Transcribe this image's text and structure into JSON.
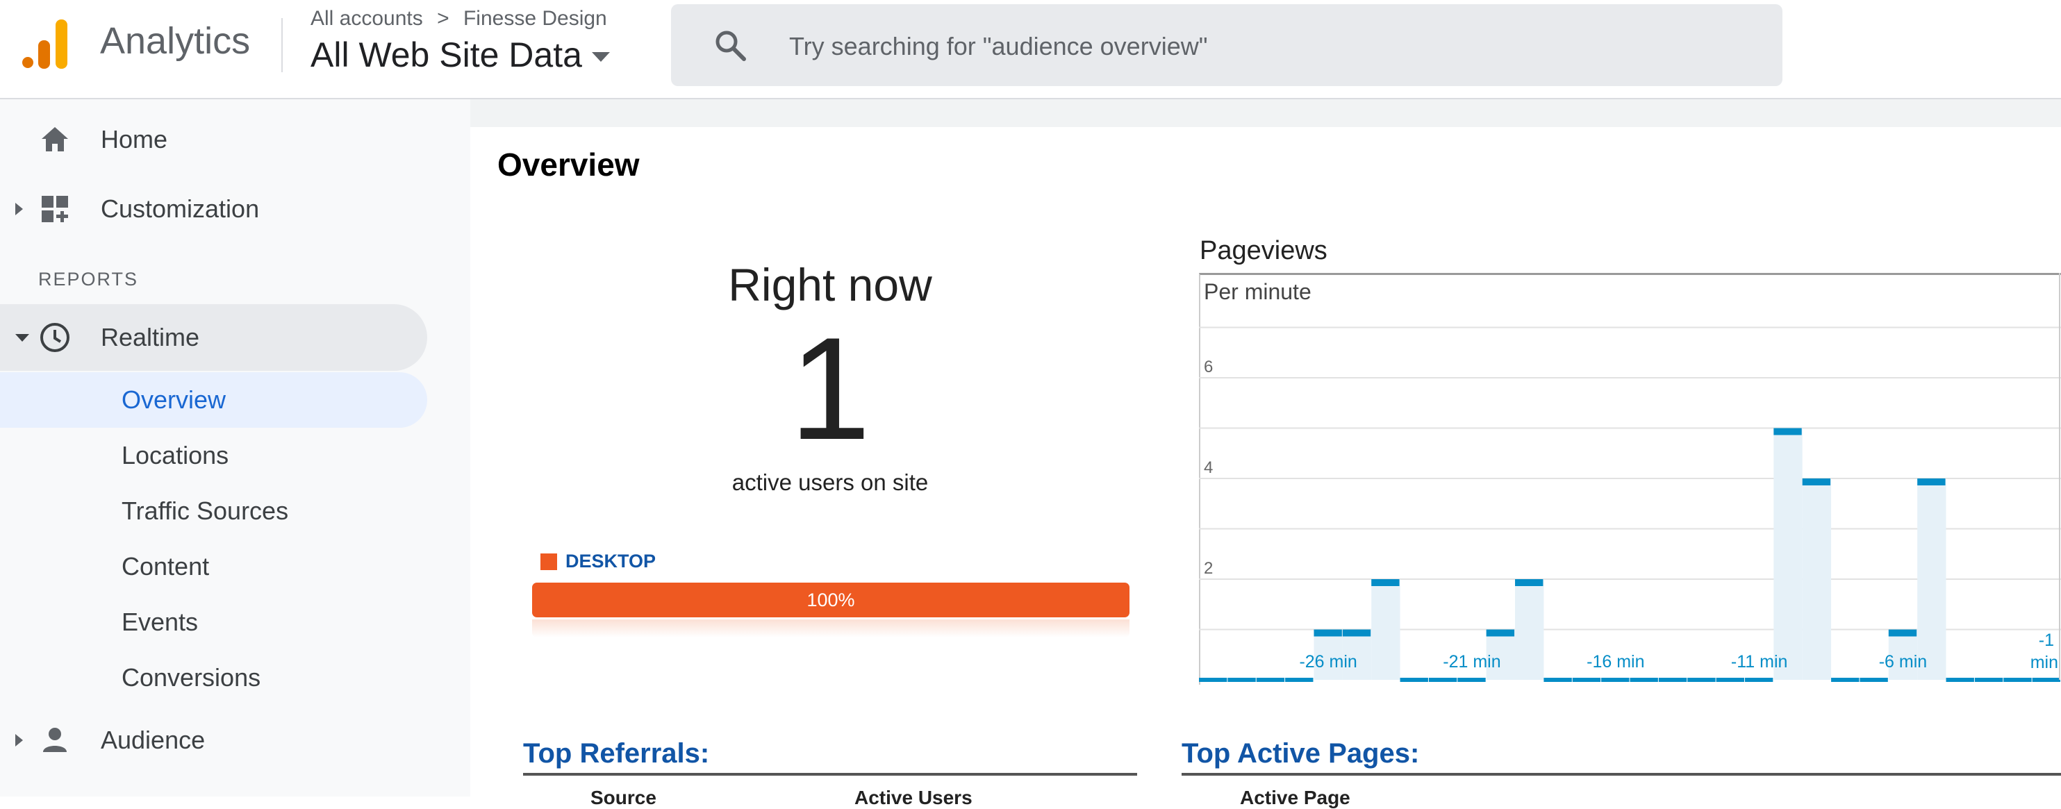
{
  "header": {
    "app_name": "Analytics",
    "breadcrumb": {
      "account": "All accounts",
      "separator": ">",
      "property": "Finesse Design"
    },
    "view": "All Web Site Data",
    "search_placeholder": "Try searching for \"audience overview\""
  },
  "sidebar": {
    "home": "Home",
    "customization": "Customization",
    "reports_heading": "REPORTS",
    "realtime": "Realtime",
    "realtime_items": [
      "Overview",
      "Locations",
      "Traffic Sources",
      "Content",
      "Events",
      "Conversions"
    ],
    "active_item": "Overview",
    "audience": "Audience"
  },
  "main": {
    "title": "Overview",
    "right_now": {
      "title": "Right now",
      "count": "1",
      "label": "active users on site"
    },
    "devices": [
      {
        "name": "DESKTOP",
        "percent_label": "100%",
        "share": 1.0,
        "color": "#ee5921"
      }
    ],
    "pageviews": {
      "title": "Pageviews",
      "subtitle": "Per minute"
    },
    "top_referrals": {
      "title": "Top Referrals:",
      "col1": "Source",
      "col2": "Active Users"
    },
    "top_active_pages": {
      "title": "Top Active Pages:",
      "col1": "Active Page"
    }
  },
  "colors": {
    "accent_blue": "#1967d2",
    "bar_blue": "#058dc7",
    "bar_fill": "#e6f1f8",
    "desktop_orange": "#ee5921",
    "title_blue": "#1155a6"
  },
  "chart_data": {
    "type": "bar",
    "title": "Pageviews",
    "subtitle": "Per minute",
    "x": [
      -30,
      -29,
      -28,
      -27,
      -26,
      -25,
      -24,
      -23,
      -22,
      -21,
      -20,
      -19,
      -18,
      -17,
      -16,
      -15,
      -14,
      -13,
      -12,
      -11,
      -10,
      -9,
      -8,
      -7,
      -6,
      -5,
      -4,
      -3,
      -2,
      -1
    ],
    "values": [
      0,
      0,
      0,
      0,
      1,
      1,
      2,
      0,
      0,
      0,
      1,
      2,
      0,
      0,
      0,
      0,
      0,
      0,
      0,
      0,
      5,
      4,
      0,
      0,
      1,
      4,
      0,
      0,
      0,
      0
    ],
    "x_tick_values": [
      -26,
      -21,
      -16,
      -11,
      -6,
      -1
    ],
    "x_tick_labels": [
      "-26 min",
      "-21 min",
      "-16 min",
      "-11 min",
      "-6 min",
      "-1 min"
    ],
    "y_ticks": [
      2,
      4,
      6
    ],
    "ylim": [
      0,
      7
    ],
    "grid": true
  }
}
